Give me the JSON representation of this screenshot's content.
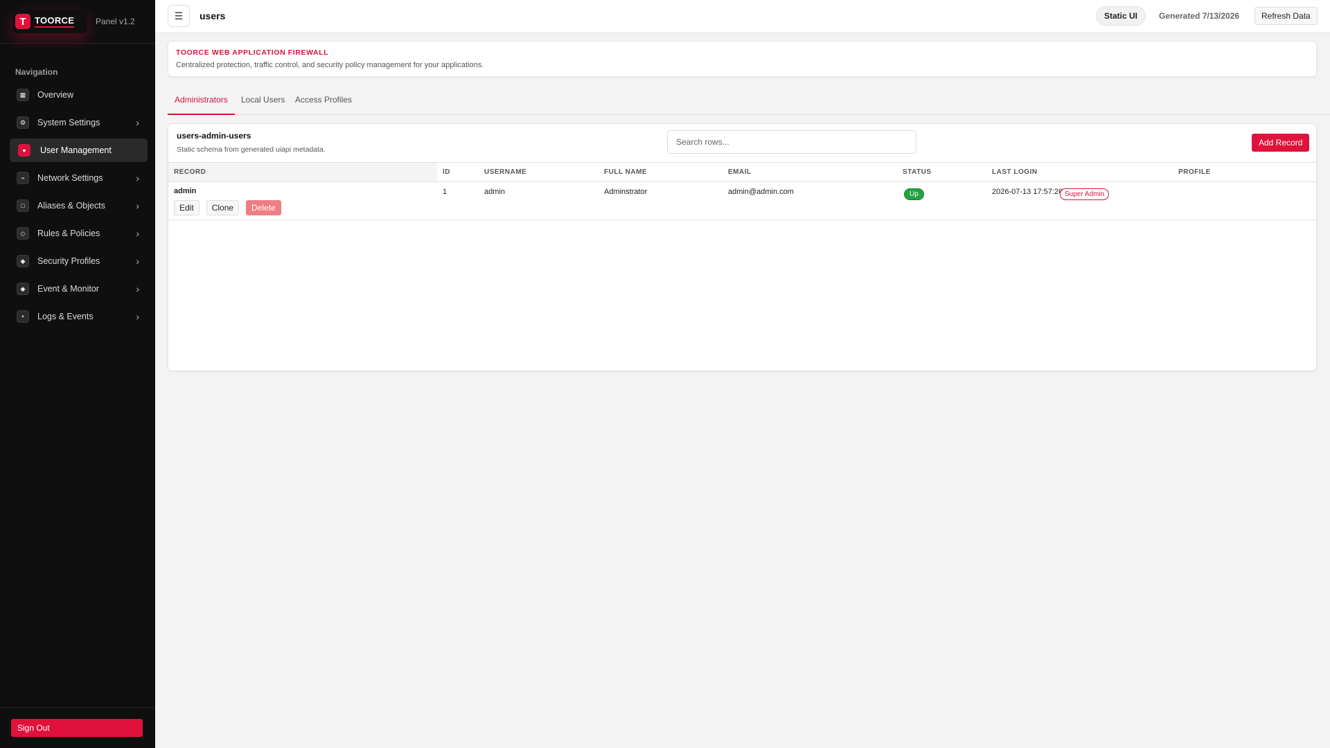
{
  "sidebar": {
    "brand_mark": "T",
    "brand_name": "TOORCE",
    "version": "Panel v1.2",
    "nav_heading": "Navigation",
    "items": [
      {
        "label": "Overview",
        "icon": "grid-icon",
        "glyph": "▦",
        "has_children": false,
        "active": false
      },
      {
        "label": "System Settings",
        "icon": "gear-icon",
        "glyph": "⚙",
        "has_children": true,
        "active": false
      },
      {
        "label": "User Management",
        "icon": "user-icon",
        "glyph": "●",
        "has_children": false,
        "active": true
      },
      {
        "label": "Network Settings",
        "icon": "network-icon",
        "glyph": "⌁",
        "has_children": true,
        "active": false
      },
      {
        "label": "Aliases & Objects",
        "icon": "square-icon",
        "glyph": "□",
        "has_children": true,
        "active": false
      },
      {
        "label": "Rules & Policies",
        "icon": "diamond-outline-icon",
        "glyph": "◇",
        "has_children": true,
        "active": false
      },
      {
        "label": "Security Profiles",
        "icon": "diamond-icon",
        "glyph": "◆",
        "has_children": true,
        "active": false
      },
      {
        "label": "Event & Monitor",
        "icon": "diamond-icon",
        "glyph": "◆",
        "has_children": true,
        "active": false
      },
      {
        "label": "Logs & Events",
        "icon": "dot-icon",
        "glyph": "•",
        "has_children": true,
        "active": false
      }
    ],
    "sign_out_label": "Sign Out"
  },
  "header": {
    "menu_glyph": "☰",
    "page_name": "users",
    "mode_pill": "Static UI",
    "generated": "Generated 7/13/2026",
    "refresh_label": "Refresh Data"
  },
  "banner": {
    "title": "TOORCE WEB APPLICATION FIREWALL",
    "description": "Centralized protection, traffic control, and security policy management for your applications."
  },
  "tabs": [
    {
      "label": "Administrators",
      "active": true
    },
    {
      "label": "Local Users",
      "active": false
    },
    {
      "label": "Access Profiles",
      "active": false
    }
  ],
  "table": {
    "title": "users-admin-users",
    "subtitle": "Static schema from generated uiapi metadata.",
    "search_placeholder": "Search rows...",
    "add_label": "Add Record",
    "columns": [
      "RECORD",
      "ID",
      "USERNAME",
      "FULL NAME",
      "EMAIL",
      "STATUS",
      "LAST LOGIN",
      "PROFILE"
    ],
    "rows": [
      {
        "record": "admin",
        "id": "1",
        "username": "admin",
        "full_name": "Adminstrator",
        "email": "admin@admin.com",
        "status": "Up",
        "last_login": "2026-07-13 17:57:26",
        "profile": "Super Admin",
        "actions": [
          "Edit",
          "Clone",
          "Delete"
        ]
      }
    ]
  },
  "colors": {
    "accent": "#e0123c",
    "sidebar_bg": "#0f0f10",
    "status_up": "#22a33e",
    "delete_btn": "#ee7d84"
  }
}
